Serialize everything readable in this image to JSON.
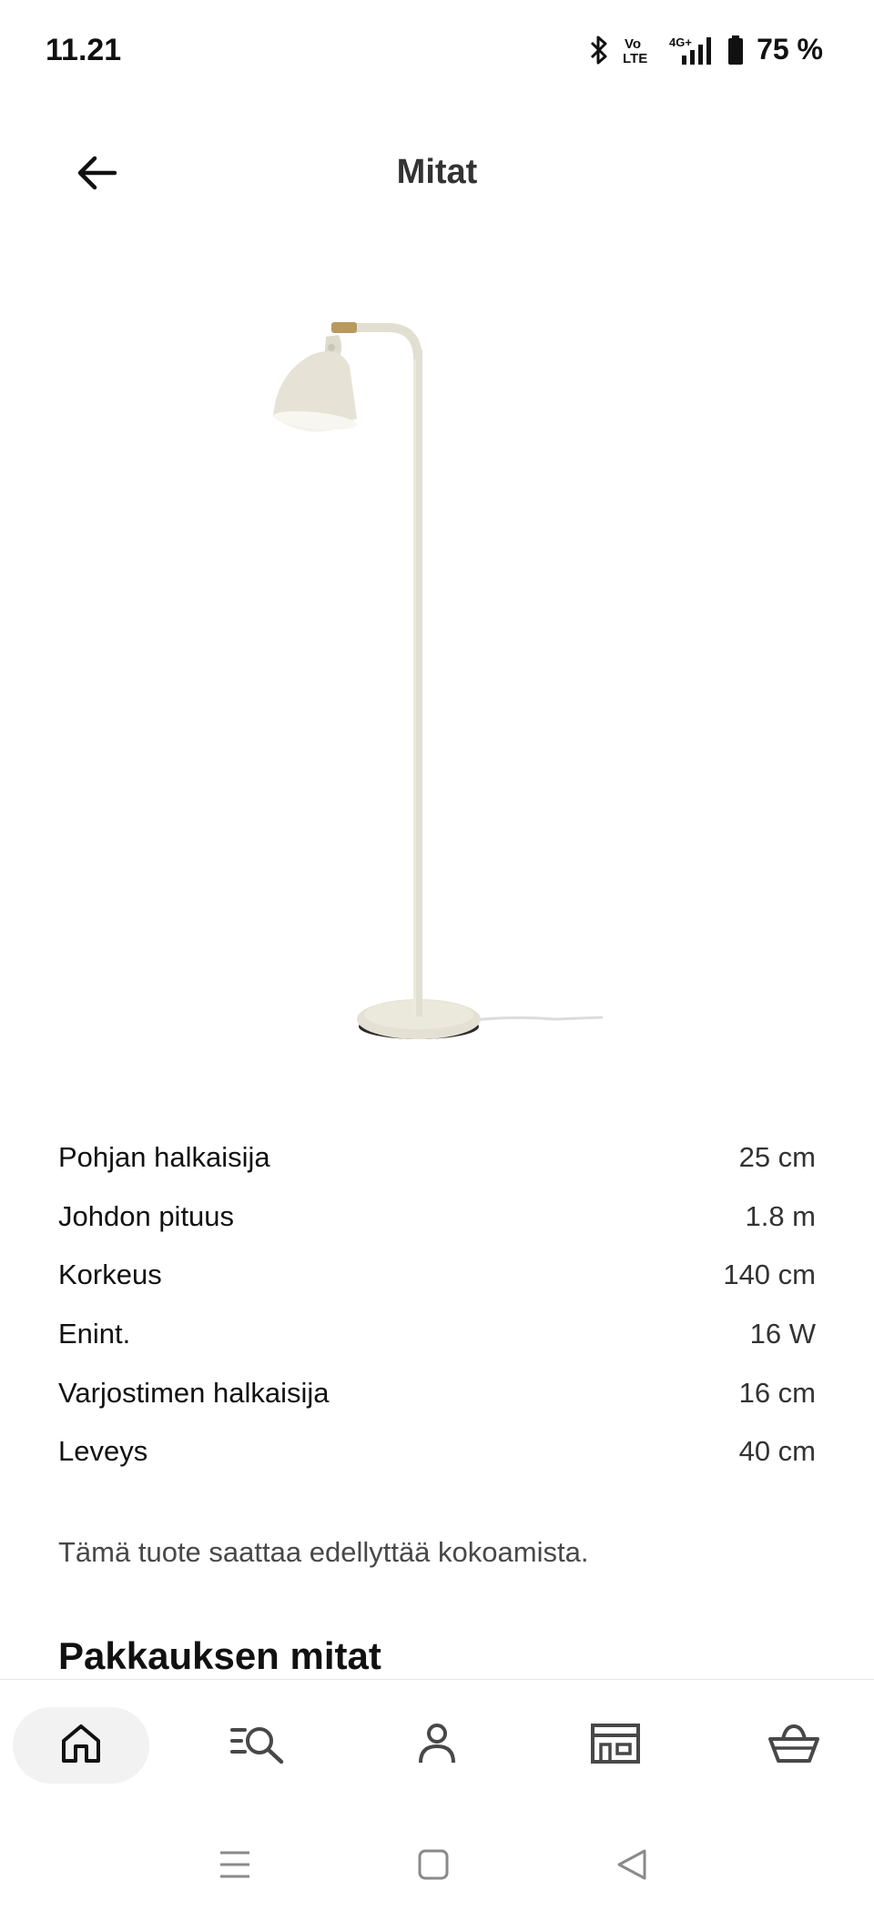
{
  "status_bar": {
    "time": "11.21",
    "battery": "75 %",
    "icons": [
      "bluetooth-icon",
      "volte-icon",
      "signal-4g-icon",
      "battery-icon"
    ]
  },
  "header": {
    "title": "Mitat",
    "back_icon": "arrow-left-icon"
  },
  "product": {
    "image_icon": "floor-lamp-image"
  },
  "dimensions": [
    {
      "label": "Pohjan halkaisija",
      "value": "25 cm"
    },
    {
      "label": "Johdon pituus",
      "value": "1.8 m"
    },
    {
      "label": "Korkeus",
      "value": "140 cm"
    },
    {
      "label": "Enint.",
      "value": "16 W"
    },
    {
      "label": "Varjostimen halkaisija",
      "value": "16 cm"
    },
    {
      "label": "Leveys",
      "value": "40 cm"
    }
  ],
  "note": "Tämä tuote saattaa edellyttää kokoamista.",
  "section_heading": "Pakkauksen mitat",
  "bottom_nav": [
    {
      "icon": "home-icon",
      "active": true
    },
    {
      "icon": "search-list-icon",
      "active": false
    },
    {
      "icon": "profile-icon",
      "active": false
    },
    {
      "icon": "store-icon",
      "active": false
    },
    {
      "icon": "basket-icon",
      "active": false
    }
  ],
  "system_nav": [
    "menu-icon",
    "home-square-icon",
    "back-triangle-icon"
  ],
  "colors": {
    "background": "#ffffff",
    "text": "#111111",
    "lamp": "#e6e3d6",
    "nav_active_bg": "#f2f2f2"
  }
}
